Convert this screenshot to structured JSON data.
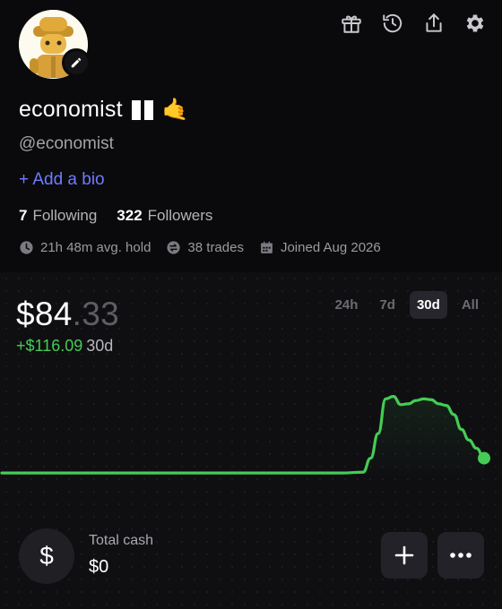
{
  "profile": {
    "display_name": "economist",
    "flag_emoji": "🇳🇬",
    "hand_emoji": "🤙",
    "handle": "@economist",
    "add_bio": "+ Add a bio",
    "following_count": "7",
    "following_label": "Following",
    "followers_count": "322",
    "followers_label": "Followers",
    "avg_hold": "21h 48m avg. hold",
    "trades": "38 trades",
    "joined": "Joined Aug 2026"
  },
  "header_icons": [
    "gift-icon",
    "history-icon",
    "share-icon",
    "settings-icon"
  ],
  "portfolio": {
    "balance_main": "$84",
    "balance_cents": ".33",
    "change_amount": "+$116.09",
    "change_period": "30d",
    "ranges": [
      {
        "label": "24h",
        "active": false
      },
      {
        "label": "7d",
        "active": false
      },
      {
        "label": "30d",
        "active": true
      },
      {
        "label": "All",
        "active": false
      }
    ]
  },
  "cash": {
    "symbol": "$",
    "label": "Total cash",
    "value": "$0"
  },
  "colors": {
    "accent_green": "#45cc55",
    "link_blue": "#6f7bff",
    "background": "#0a0a0c"
  },
  "chart_data": {
    "type": "line",
    "series": [
      {
        "values": [
          0.02,
          0.02,
          0.02,
          0.02,
          0.02,
          0.02,
          0.02,
          0.02,
          0.02,
          0.02,
          0.02,
          0.02,
          0.02,
          0.02,
          0.02,
          0.02,
          0.02,
          0.03,
          0.2,
          0.5,
          0.92,
          0.95,
          0.85,
          0.86,
          0.9,
          0.92,
          0.91,
          0.86,
          0.84,
          0.73,
          0.55,
          0.42,
          0.32,
          0.2
        ]
      }
    ],
    "ylim": [
      0,
      1
    ],
    "grid": false
  }
}
